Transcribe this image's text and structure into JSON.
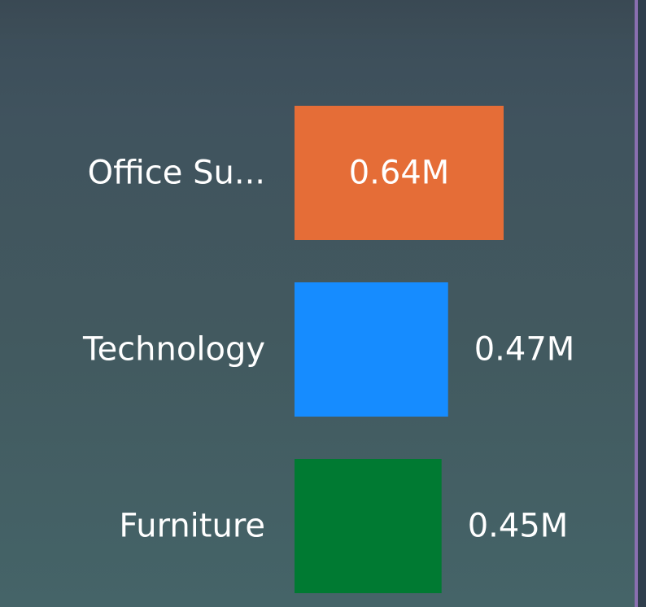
{
  "chart_data": {
    "type": "bar",
    "orientation": "horizontal",
    "categories": [
      "Office Su...",
      "Technology",
      "Furniture"
    ],
    "values": [
      0.64,
      0.47,
      0.45
    ],
    "value_labels": [
      "0.64M",
      "0.47M",
      "0.45M"
    ],
    "colors": [
      "#e56d37",
      "#168cff",
      "#007a32"
    ],
    "xlim": [
      0,
      0.64
    ],
    "grid": false,
    "legend": "none"
  }
}
